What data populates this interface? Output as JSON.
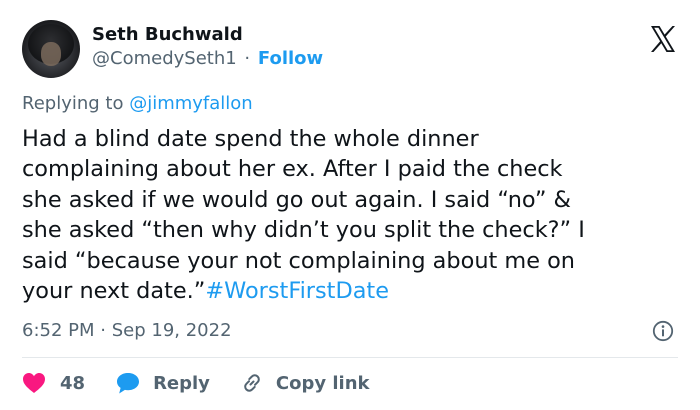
{
  "author": {
    "display_name": "Seth Buchwald",
    "handle": "@ComedySeth1",
    "separator": "·",
    "follow_label": "Follow"
  },
  "platform_icon": "x-logo-icon",
  "reply_context": {
    "prefix": "Replying to ",
    "mention": "@jimmyfallon"
  },
  "tweet": {
    "text": "Had a blind date spend the whole dinner\ncomplaining about her ex. After I paid the check\nshe asked if we would go out again. I said “no” &\nshe asked “then why didn’t you split the check?” I\nsaid “because your not complaining about me on\nyour next date.”",
    "hashtag": "#WorstFirstDate"
  },
  "meta": {
    "time": "6:52 PM",
    "separator": "·",
    "date": "Sep 19, 2022",
    "info_icon": "info-icon"
  },
  "actions": {
    "like_count": "48",
    "like_icon": "heart-icon",
    "reply_label": "Reply",
    "reply_icon": "speech-bubble-icon",
    "copy_label": "Copy link",
    "copy_icon": "link-icon"
  },
  "colors": {
    "accent": "#1d9bf0",
    "like": "#f91880",
    "text": "#0f1419",
    "muted": "#536471",
    "divider": "#e4e8eb"
  }
}
